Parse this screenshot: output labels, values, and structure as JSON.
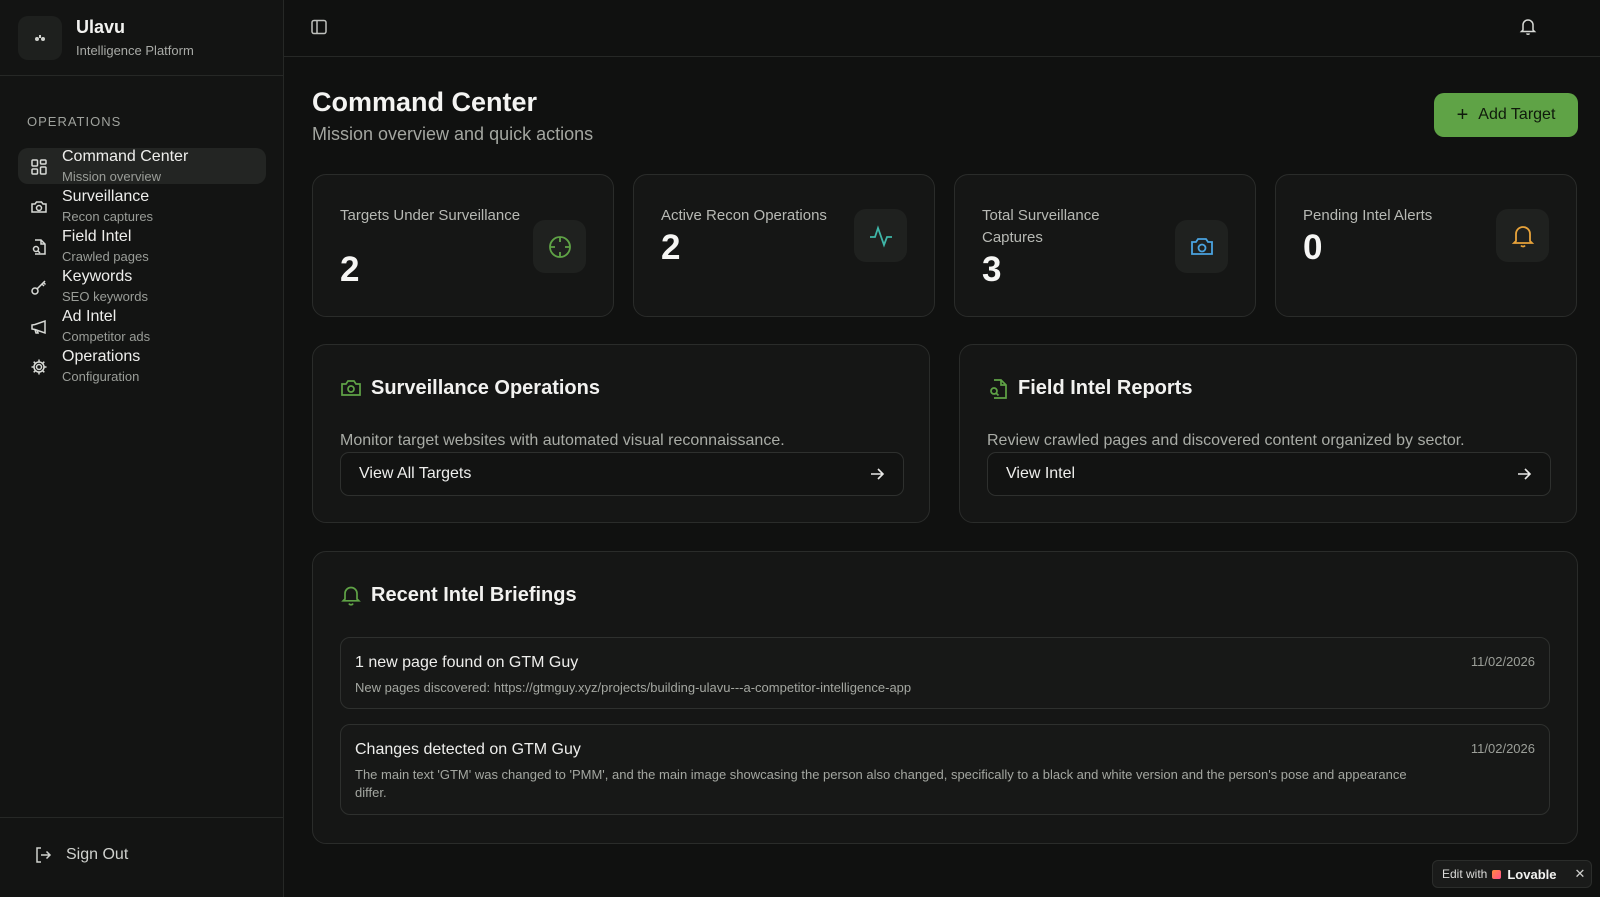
{
  "brand": {
    "name": "Ulavu",
    "subtitle": "Intelligence Platform"
  },
  "sidebar": {
    "section_label": "OPERATIONS",
    "items": [
      {
        "label": "Command Center",
        "sub": "Mission overview",
        "icon": "grid-icon",
        "active": true
      },
      {
        "label": "Surveillance",
        "sub": "Recon captures",
        "icon": "camera-icon"
      },
      {
        "label": "Field Intel",
        "sub": "Crawled pages",
        "icon": "file-search-icon"
      },
      {
        "label": "Keywords",
        "sub": "SEO keywords",
        "icon": "key-icon"
      },
      {
        "label": "Ad Intel",
        "sub": "Competitor ads",
        "icon": "megaphone-icon"
      },
      {
        "label": "Operations",
        "sub": "Configuration",
        "icon": "gear-icon"
      }
    ],
    "sign_out": "Sign Out"
  },
  "header": {
    "title": "Command Center",
    "subtitle": "Mission overview and quick actions",
    "add_button": "Add Target"
  },
  "stats": [
    {
      "label": "Targets Under Surveillance",
      "value": "2",
      "icon": "crosshair-icon",
      "color": "#5fa346"
    },
    {
      "label": "Active Recon Operations",
      "value": "2",
      "icon": "activity-icon",
      "color": "#3fb6a8"
    },
    {
      "label": "Total Surveillance Captures",
      "value": "3",
      "icon": "camera-icon",
      "color": "#4aa3df"
    },
    {
      "label": "Pending Intel Alerts",
      "value": "0",
      "icon": "bell-icon",
      "color": "#e8a33a"
    }
  ],
  "panels": {
    "surveillance": {
      "title": "Surveillance Operations",
      "description": "Monitor target websites with automated visual reconnaissance.",
      "button": "View All Targets"
    },
    "field_intel": {
      "title": "Field Intel Reports",
      "description": "Review crawled pages and discovered content organized by sector.",
      "button": "View Intel"
    }
  },
  "briefings": {
    "title": "Recent Intel Briefings",
    "items": [
      {
        "title": "1 new page found on GTM Guy",
        "date": "11/02/2026",
        "body": "New pages discovered: https://gtmguy.xyz/projects/building-ulavu---a-competitor-intelligence-app"
      },
      {
        "title": "Changes detected on GTM Guy",
        "date": "11/02/2026",
        "body": "The main text 'GTM' was changed to 'PMM', and the main image showcasing the person also changed, specifically to a black and white version and the person's pose and appearance differ."
      }
    ]
  },
  "badge": {
    "prefix": "Edit with",
    "brand": "Lovable",
    "close": "✕"
  },
  "colors": {
    "accent": "#5fa346",
    "background": "#101110"
  }
}
